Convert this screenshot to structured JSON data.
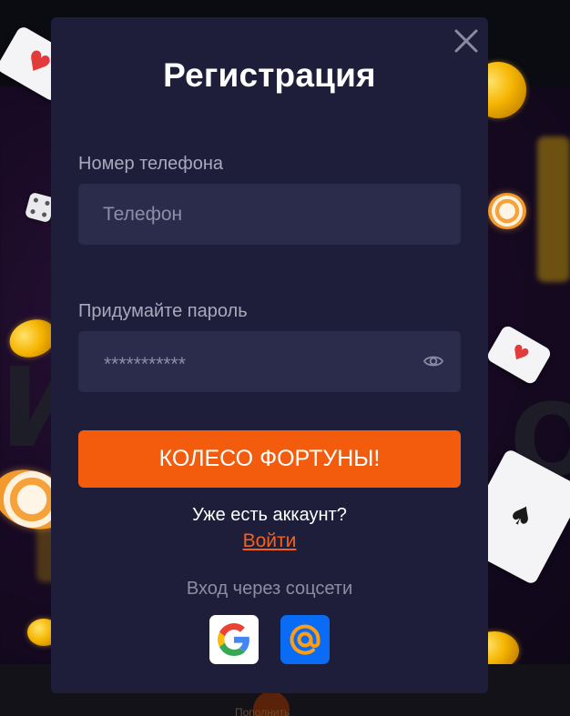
{
  "modal": {
    "title": "Регистрация",
    "close_icon": "close-icon",
    "phone": {
      "label": "Номер телефона",
      "placeholder": "Телефон",
      "value": ""
    },
    "password": {
      "label": "Придумайте пароль",
      "masked_value": "***********",
      "toggle_icon": "eye-icon"
    },
    "submit_label": "КОЛЕСО ФОРТУНЫ!",
    "account_question": "Уже есть аккаунт?",
    "login_link": "Войти",
    "social": {
      "label": "Вход через соцсети",
      "providers": [
        {
          "name": "google",
          "icon": "google-icon"
        },
        {
          "name": "mail",
          "icon": "at-sign-icon"
        }
      ]
    }
  },
  "background": {
    "bottom_nav_label": "Пополнить"
  },
  "colors": {
    "modal_bg": "#1e1e3a",
    "input_bg": "#2b2b4b",
    "accent": "#f45c0d",
    "link": "#f4621a",
    "mail_blue": "#0a6cf5"
  }
}
